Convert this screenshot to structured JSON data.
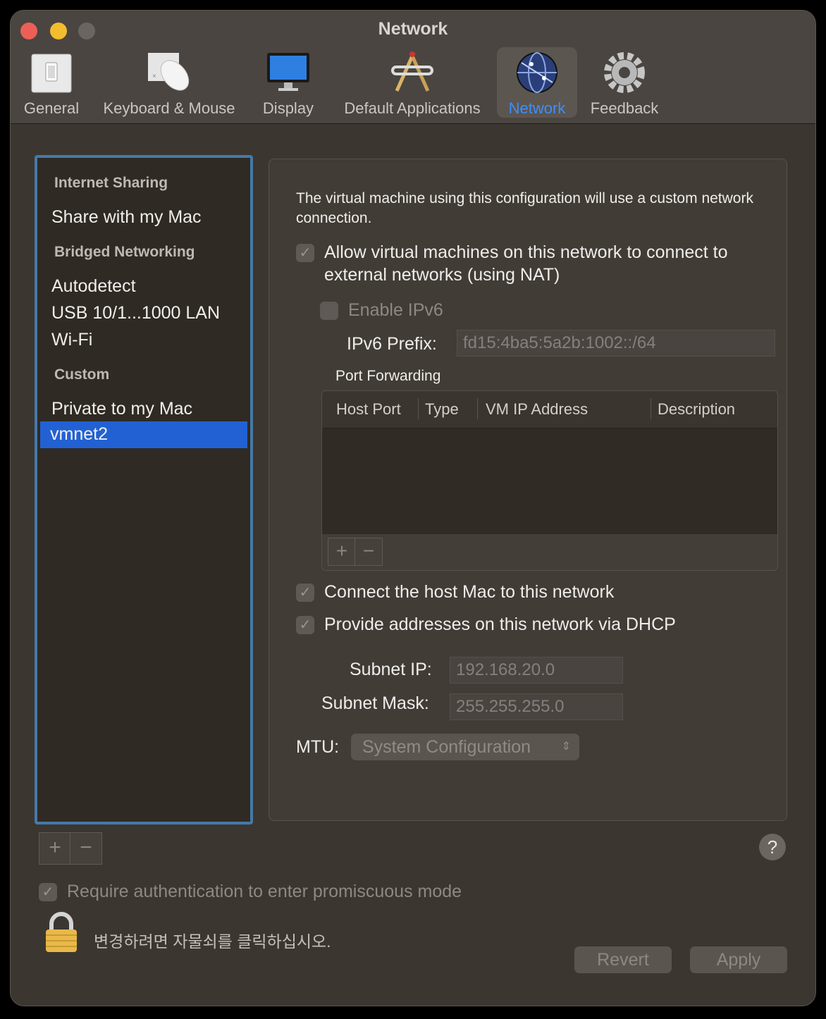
{
  "window": {
    "title": "Network"
  },
  "toolbar": [
    {
      "label": "General",
      "icon": "general-icon"
    },
    {
      "label": "Keyboard & Mouse",
      "icon": "mouse-icon"
    },
    {
      "label": "Display",
      "icon": "display-icon"
    },
    {
      "label": "Default Applications",
      "icon": "applications-icon"
    },
    {
      "label": "Network",
      "icon": "globe-icon",
      "selected": true
    },
    {
      "label": "Feedback",
      "icon": "gear-icon"
    }
  ],
  "sidebar": {
    "sections": [
      {
        "header": "Internet Sharing",
        "items": [
          "Share with my Mac"
        ]
      },
      {
        "header": "Bridged Networking",
        "items": [
          "Autodetect",
          "USB 10/1...1000 LAN",
          "Wi-Fi"
        ]
      },
      {
        "header": "Custom",
        "items": [
          "Private to my Mac",
          "vmnet2"
        ]
      }
    ],
    "selected_item": "vmnet2",
    "add_label": "+",
    "remove_label": "−"
  },
  "panel": {
    "description": "The virtual machine using this configuration will use a custom network connection.",
    "nat_label": "Allow virtual machines on this network to connect to external networks (using NAT)",
    "nat_checked": true,
    "ipv6_label": "Enable IPv6",
    "ipv6_checked": false,
    "ipv6_prefix_label": "IPv6 Prefix:",
    "ipv6_prefix_value": "fd15:4ba5:5a2b:1002::/64",
    "port_forwarding_label": "Port Forwarding",
    "port_forwarding_columns": [
      "Host Port",
      "Type",
      "VM IP Address",
      "Description"
    ],
    "port_forwarding_rows": [],
    "pf_add_label": "+",
    "pf_remove_label": "−",
    "connect_host_label": "Connect the host Mac to this network",
    "connect_host_checked": true,
    "dhcp_label": "Provide addresses on this network via DHCP",
    "dhcp_checked": true,
    "subnet_ip_label": "Subnet IP:",
    "subnet_ip_value": "192.168.20.0",
    "subnet_mask_label": "Subnet Mask:",
    "subnet_mask_value": "255.255.255.0",
    "mtu_label": "MTU:",
    "mtu_value": "System Configuration"
  },
  "footer": {
    "promiscuous_label": "Require authentication to enter promiscuous mode",
    "promiscuous_checked": true,
    "lock_text": "변경하려면 자물쇠를 클릭하십시오.",
    "revert_label": "Revert",
    "apply_label": "Apply",
    "help_label": "?"
  },
  "colors": {
    "accent": "#2261d4",
    "selection_text": "#3d8eff",
    "close": "#ec5f56",
    "minimize": "#f2bc2e",
    "zoom": "#6a6560"
  }
}
